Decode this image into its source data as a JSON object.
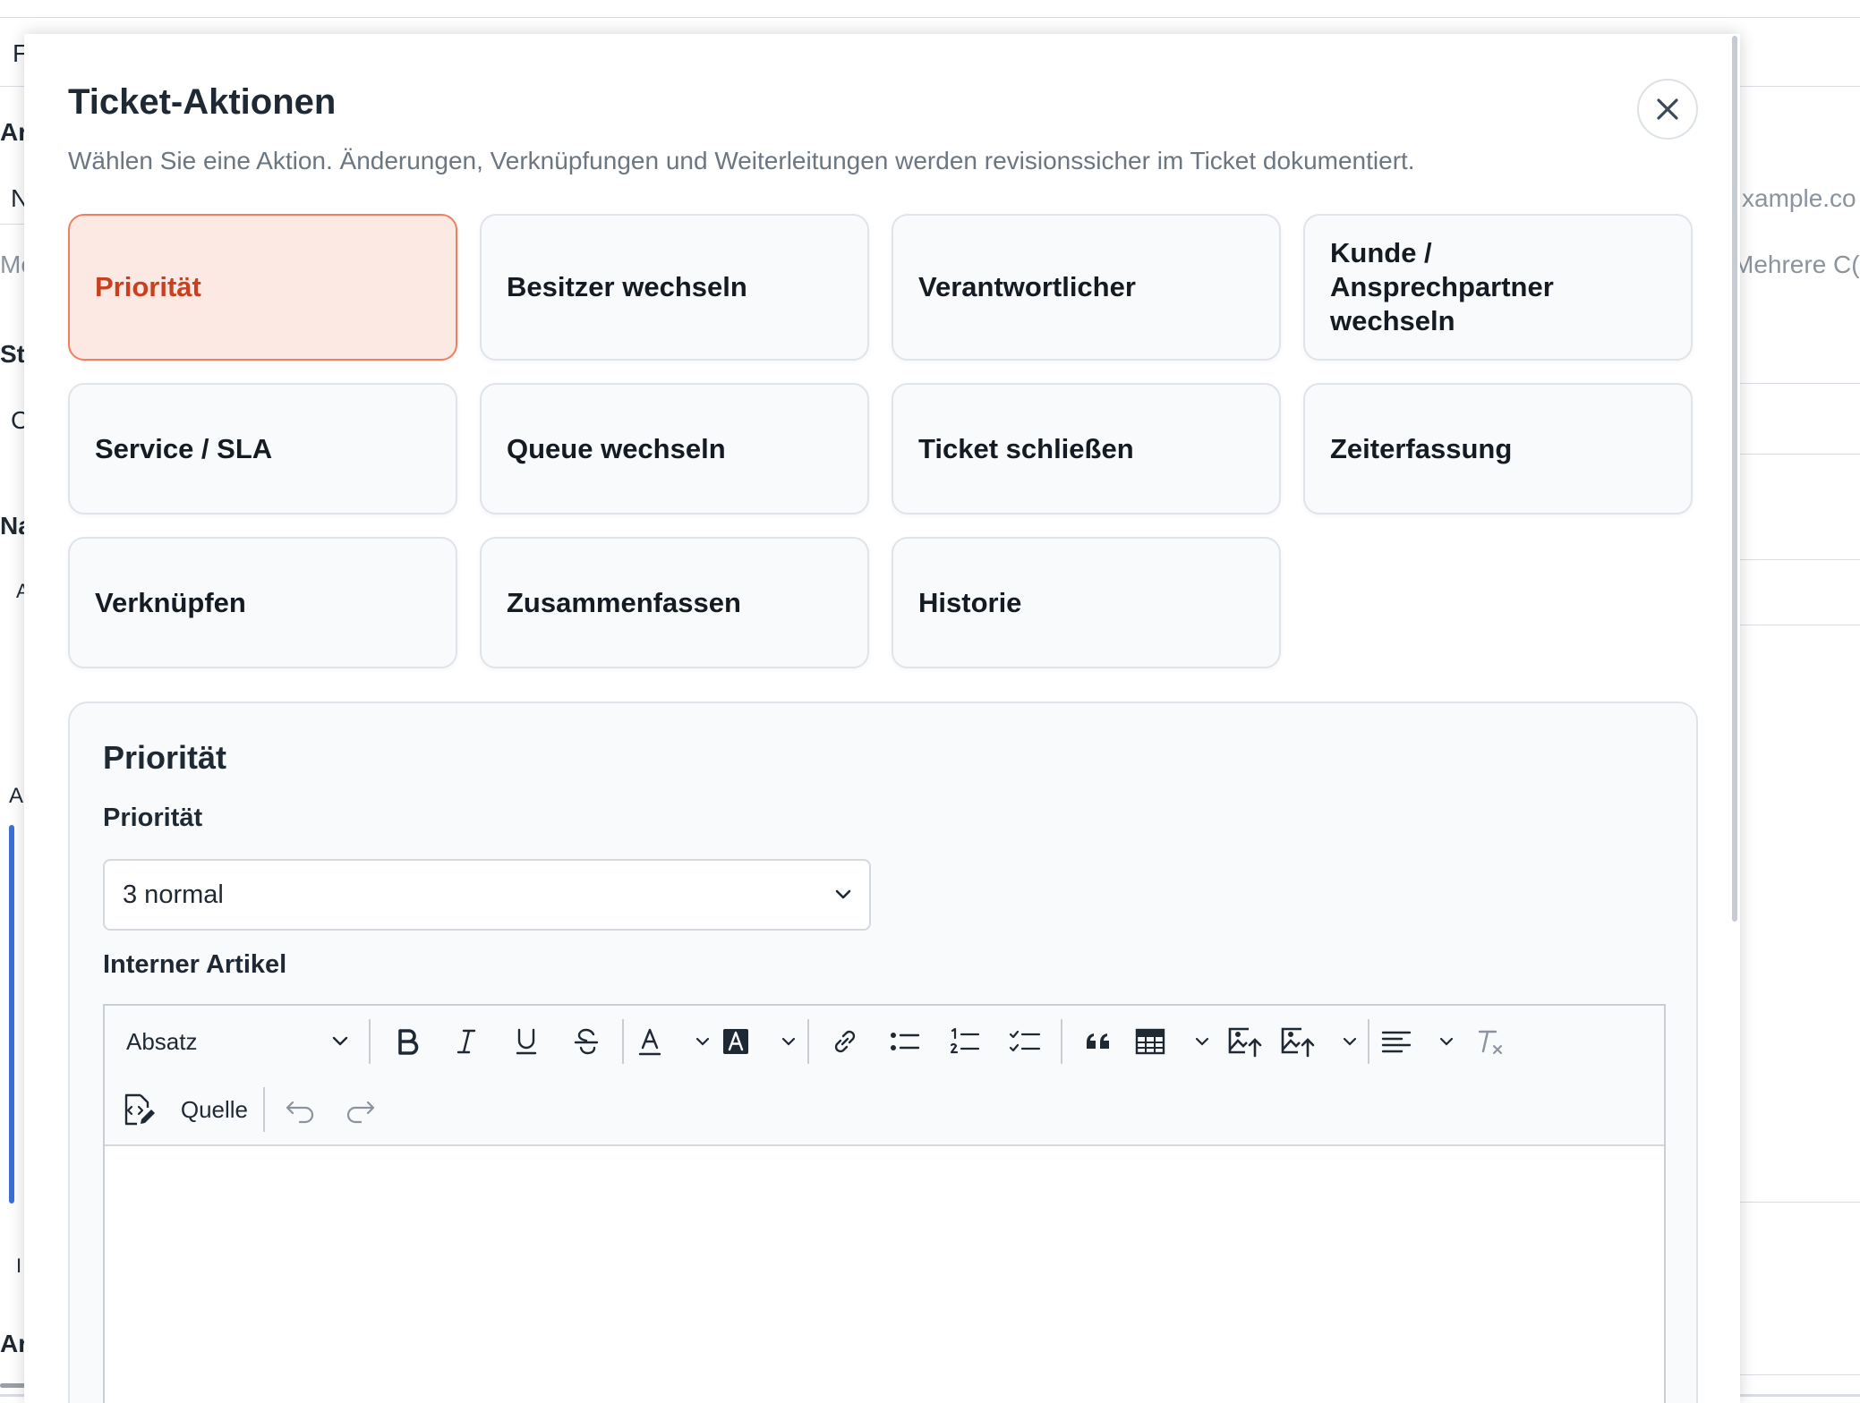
{
  "background": {
    "fragments": [
      "F",
      "Ar",
      "N",
      "Me",
      "St",
      "C",
      "Na",
      "A",
      "A",
      "I",
      "Ar"
    ],
    "right_email": "xample.co",
    "right_cc": "Mehrere C("
  },
  "modal": {
    "title": "Ticket-Aktionen",
    "description": "Wählen Sie eine Aktion. Änderungen, Verknüpfungen und Weiterleitungen werden revisionssicher im Ticket dokumentiert.",
    "close_label": "Schließen",
    "actions": [
      {
        "label": "Priorität",
        "active": true
      },
      {
        "label": "Besitzer wechseln",
        "active": false
      },
      {
        "label": "Verantwortlicher",
        "active": false
      },
      {
        "label": "Kunde / Ansprechpartner wechseln",
        "active": false
      },
      {
        "label": "Service / SLA",
        "active": false
      },
      {
        "label": "Queue wechseln",
        "active": false
      },
      {
        "label": "Ticket schließen",
        "active": false
      },
      {
        "label": "Zeiterfassung",
        "active": false
      },
      {
        "label": "Verknüpfen",
        "active": false
      },
      {
        "label": "Zusammenfassen",
        "active": false
      },
      {
        "label": "Historie",
        "active": false
      }
    ],
    "panel": {
      "title": "Priorität",
      "priority_label": "Priorität",
      "priority_value": "3 normal",
      "article_label": "Interner Artikel",
      "editor": {
        "heading_select": "Absatz",
        "source_label": "Quelle",
        "body": ""
      }
    }
  },
  "colors": {
    "active_bg": "#fde9e3",
    "active_border": "#f07f62",
    "active_text": "#c8401f",
    "card_bg": "#f9fafc",
    "accent_blue": "#3b6fd8"
  }
}
